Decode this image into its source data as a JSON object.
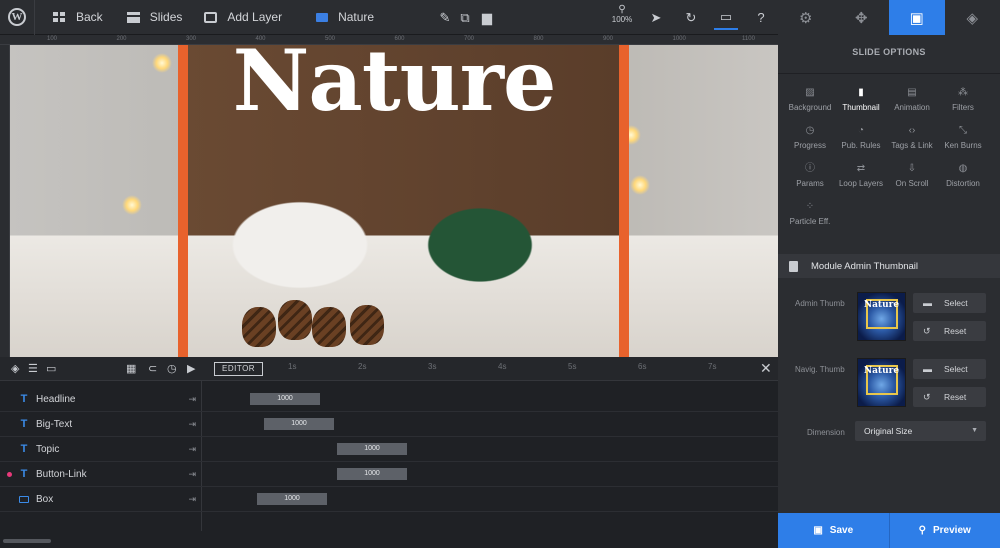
{
  "topbar": {
    "back_label": "Back",
    "slides_label": "Slides",
    "add_layer_label": "Add Layer",
    "slide_name": "Nature",
    "zoom_label": "100%"
  },
  "icons": {
    "wordpress": "wordpress-icon",
    "back": "grid-icon",
    "slides": "slides-icon",
    "add_layer": "add-layer-icon",
    "slide": "image-icon",
    "edit": "pencil-icon",
    "duplicate": "copy-icon",
    "delete": "trash-icon",
    "zoom": "magnifier-icon",
    "cursor": "cursor-icon",
    "undo": "undo-icon",
    "device": "monitor-icon",
    "help": "help-icon"
  },
  "right_tabs": [
    {
      "name": "settings",
      "icon": "gear-icon",
      "glyph": "⚙",
      "active": false
    },
    {
      "name": "navigation",
      "icon": "gamepad-icon",
      "glyph": "✥",
      "active": false
    },
    {
      "name": "slide",
      "icon": "slide-icon",
      "glyph": "▣",
      "active": true
    },
    {
      "name": "layers",
      "icon": "layers-icon",
      "glyph": "◈",
      "active": false
    }
  ],
  "ruler": {
    "labels": [
      "100",
      "200",
      "300",
      "400",
      "500",
      "600",
      "700",
      "800",
      "900",
      "1000",
      "1100"
    ]
  },
  "canvas": {
    "headline": "Nature"
  },
  "timeline": {
    "editor_label": "EDITOR",
    "ticks": [
      "1s",
      "2s",
      "3s",
      "4s",
      "5s",
      "6s",
      "7s"
    ],
    "layers": [
      {
        "type": "text",
        "name": "Headline",
        "duration": "1000",
        "marked": false
      },
      {
        "type": "text",
        "name": "Big-Text",
        "duration": "1000",
        "marked": false
      },
      {
        "type": "text",
        "name": "Topic",
        "duration": "1000",
        "marked": false
      },
      {
        "type": "text",
        "name": "Button-Link",
        "duration": "1000",
        "marked": true
      },
      {
        "type": "box",
        "name": "Box",
        "duration": "1000",
        "marked": false
      }
    ]
  },
  "panel": {
    "title": "SLIDE OPTIONS",
    "options": [
      {
        "label": "Background",
        "icon": "image-icon",
        "glyph": "▨",
        "active": false
      },
      {
        "label": "Thumbnail",
        "icon": "thumbnail-icon",
        "glyph": "▮",
        "active": true
      },
      {
        "label": "Animation",
        "icon": "film-icon",
        "glyph": "▤",
        "active": false
      },
      {
        "label": "Filters",
        "icon": "filters-icon",
        "glyph": "⁂",
        "active": false
      },
      {
        "label": "Progress",
        "icon": "stopwatch-icon",
        "glyph": "◷",
        "active": false
      },
      {
        "label": "Pub. Rules",
        "icon": "clock-icon",
        "glyph": "◔",
        "active": false
      },
      {
        "label": "Tags & Link",
        "icon": "code-icon",
        "glyph": "‹›",
        "active": false
      },
      {
        "label": "Ken Burns",
        "icon": "kenburns-icon",
        "glyph": "⤡",
        "active": false
      },
      {
        "label": "Params",
        "icon": "info-icon",
        "glyph": "ⓘ",
        "active": false
      },
      {
        "label": "Loop Layers",
        "icon": "loop-icon",
        "glyph": "⇄",
        "active": false
      },
      {
        "label": "On Scroll",
        "icon": "scroll-icon",
        "glyph": "⇩",
        "active": false
      },
      {
        "label": "Distortion",
        "icon": "distortion-icon",
        "glyph": "◍",
        "active": false
      },
      {
        "label": "Particle Eff.",
        "icon": "particles-icon",
        "glyph": "⁘",
        "active": false
      }
    ],
    "section_title": "Module Admin Thumbnail",
    "admin_thumb_label": "Admin Thumb",
    "navig_thumb_label": "Navig. Thumb",
    "thumb_text": "Nature",
    "select_label": "Select",
    "reset_label": "Reset",
    "dimension_label": "Dimension",
    "dimension_value": "Original Size"
  },
  "actions": {
    "save_label": "Save",
    "preview_label": "Preview"
  },
  "colors": {
    "accent": "#2e7ee8",
    "guide": "#e8622c",
    "marker": "#e8397a"
  }
}
